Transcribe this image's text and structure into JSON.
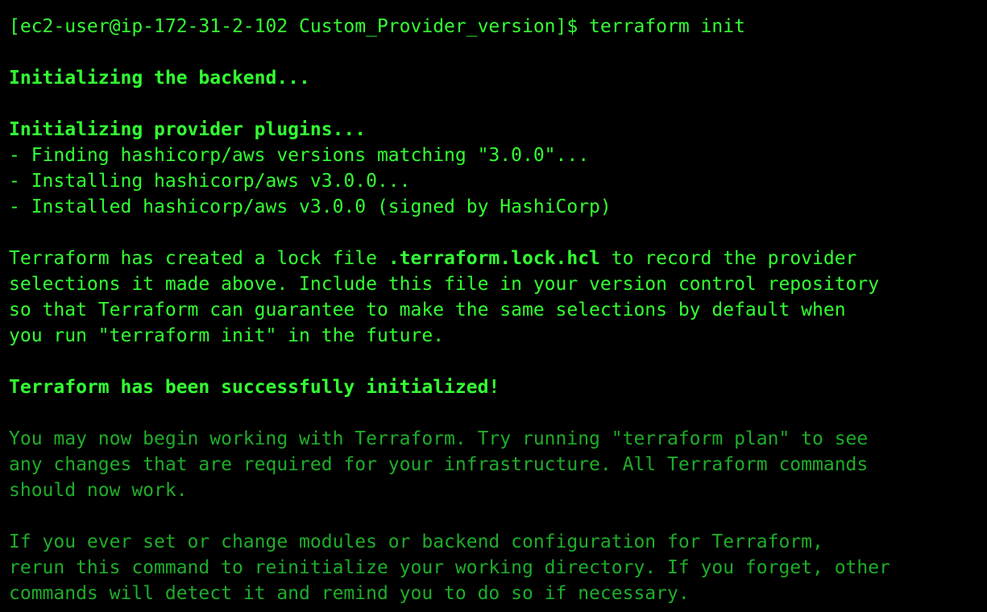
{
  "terminal": {
    "prompt": "[ec2-user@ip-172-31-2-102 Custom_Provider_version]$ terraform init",
    "init_backend": "Initializing the backend...",
    "init_plugins": "Initializing provider plugins...",
    "plugin_lines": [
      "- Finding hashicorp/aws versions matching \"3.0.0\"...",
      "- Installing hashicorp/aws v3.0.0...",
      "- Installed hashicorp/aws v3.0.0 (signed by HashiCorp)"
    ],
    "lock_pre": "Terraform has created a lock file ",
    "lock_file": ".terraform.lock.hcl",
    "lock_post": " to record the provider",
    "lock_lines": [
      "selections it made above. Include this file in your version control repository",
      "so that Terraform can guarantee to make the same selections by default when",
      "you run \"terraform init\" in the future."
    ],
    "success": "Terraform has been successfully initialized!",
    "next_steps": [
      "You may now begin working with Terraform. Try running \"terraform plan\" to see",
      "any changes that are required for your infrastructure. All Terraform commands",
      "should now work."
    ],
    "reinit": [
      "If you ever set or change modules or backend configuration for Terraform,",
      "rerun this command to reinitialize your working directory. If you forget, other",
      "commands will detect it and remind you to do so if necessary."
    ]
  },
  "colors": {
    "background": "#000000",
    "bright_green": "#33ff33",
    "dim_green": "#1fad2a"
  }
}
